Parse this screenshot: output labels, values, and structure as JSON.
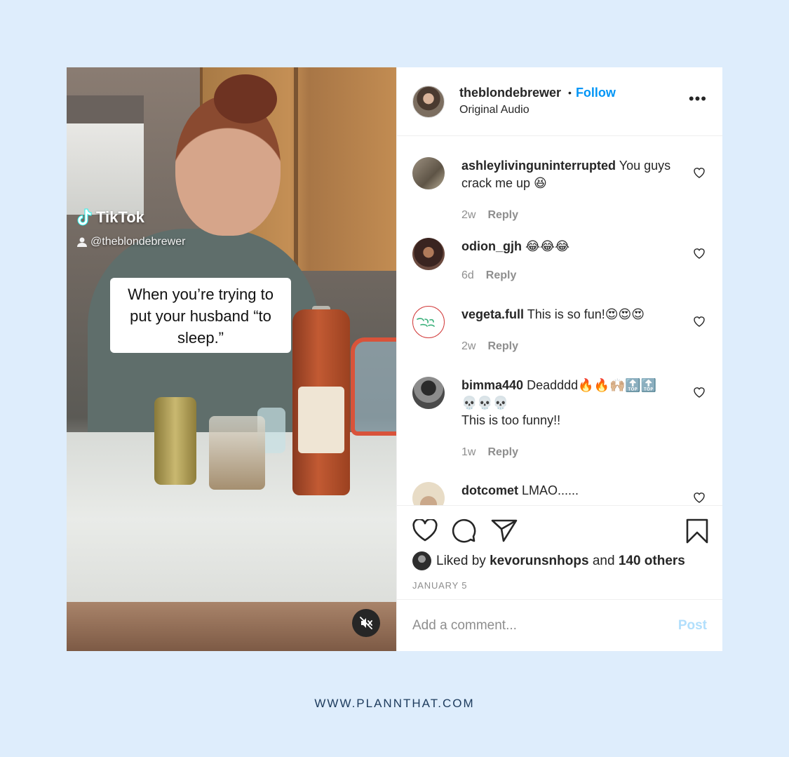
{
  "post": {
    "username": "theblondebrewer",
    "separator": "•",
    "follow_label": "Follow",
    "audio": "Original Audio",
    "more_label": "•••"
  },
  "video": {
    "watermark_brand": "TikTok",
    "watermark_handle": "@theblondebrewer",
    "caption": "When you’re trying to put your husband “to sleep.”",
    "muted": true
  },
  "comments": [
    {
      "user": "ashleylivinguninterrupted",
      "text": "You guys crack me up 😆",
      "time": "2w",
      "reply": "Reply",
      "avatar_color": "#8a7f6e"
    },
    {
      "user": "odion_gjh",
      "text": "😂😂😂",
      "time": "6d",
      "reply": "Reply",
      "avatar_color": "#5a3b31"
    },
    {
      "user": "vegeta.full",
      "text": "This is so fun!😍😍😍",
      "time": "2w",
      "reply": "Reply",
      "avatar_color": "#ffffff"
    },
    {
      "user": "bimma440",
      "text": "Deadddd🔥🔥🙌🏼🔝🔝💀💀💀",
      "text2": "This is too funny!!",
      "time": "1w",
      "reply": "Reply",
      "avatar_color": "#3a3a3a"
    },
    {
      "user": "dotcomet",
      "text": "LMAO......",
      "time": "",
      "reply": "",
      "avatar_color": "#d8c9a8"
    }
  ],
  "likes": {
    "prefix": "Liked by",
    "liker": "kevorunsnhops",
    "connector": "and",
    "others": "140 others"
  },
  "date": "JANUARY 5",
  "add_comment": {
    "placeholder": "Add a comment...",
    "post_label": "Post"
  },
  "footer": "WWW.PLANNTHAT.COM",
  "colors": {
    "background": "#deedfc",
    "follow": "#0095f6",
    "post_disabled": "#b2dffc",
    "footer": "#1c3a5c"
  }
}
